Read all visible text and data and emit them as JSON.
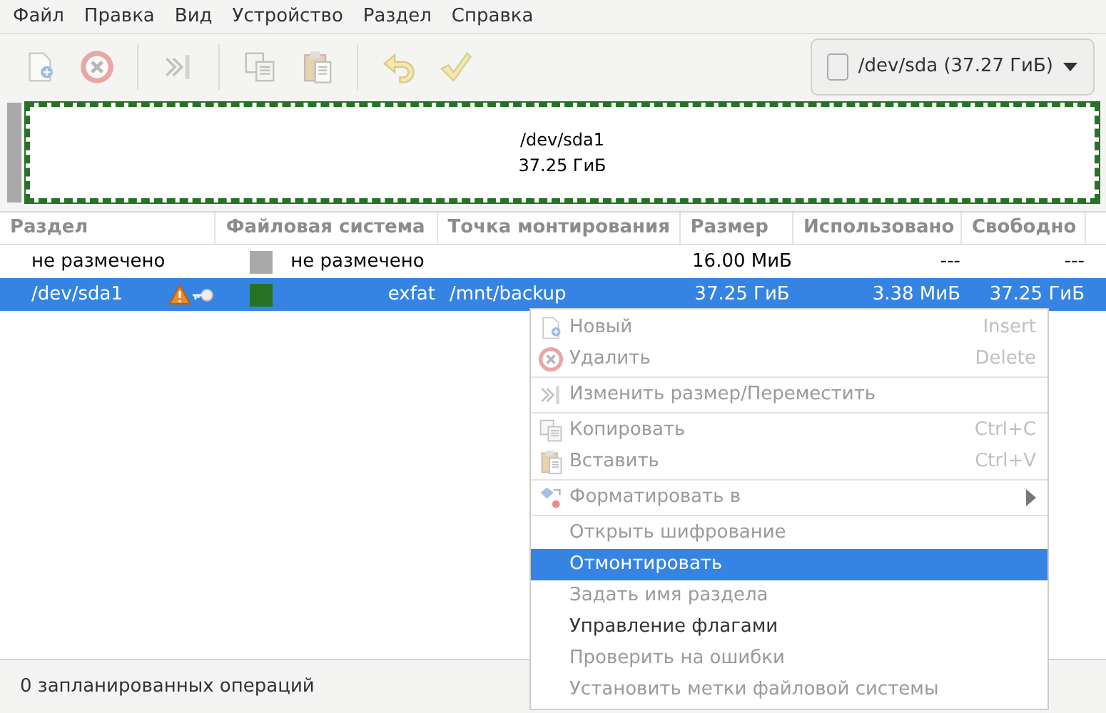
{
  "menubar": [
    "Файл",
    "Правка",
    "Вид",
    "Устройство",
    "Раздел",
    "Справка"
  ],
  "toolbar": [
    {
      "kind": "new",
      "disabled": true
    },
    {
      "kind": "delete",
      "disabled": true
    },
    {
      "kind": "separator"
    },
    {
      "kind": "resize",
      "disabled": true
    },
    {
      "kind": "separator"
    },
    {
      "kind": "copy",
      "disabled": true
    },
    {
      "kind": "paste",
      "disabled": true
    },
    {
      "kind": "separator"
    },
    {
      "kind": "undo",
      "disabled": true
    },
    {
      "kind": "apply",
      "disabled": true
    }
  ],
  "device_selector": {
    "value": "/dev/sda (37.27 ГиБ)"
  },
  "disk_graph": [
    {
      "kind": "unallocated",
      "color": "#a9a9a9"
    },
    {
      "kind": "partition",
      "color": "#267326",
      "name": "/dev/sda1",
      "size": "37.25 ГиБ"
    }
  ],
  "table": {
    "columns": [
      "Раздел",
      "Файловая система",
      "Точка монтирования",
      "Размер",
      "Использовано",
      "Свободно"
    ],
    "rows": [
      {
        "partition": "не размечено",
        "warning": false,
        "locked": false,
        "color": "#a9a9a9",
        "filesystem": "не размечено",
        "mount_point": "",
        "size": "16.00 МиБ",
        "used": "---",
        "free": "---",
        "selected": false
      },
      {
        "partition": "/dev/sda1",
        "warning": true,
        "locked": true,
        "color": "#267326",
        "filesystem": "exfat",
        "mount_point": "/mnt/backup",
        "size": "37.25 ГиБ",
        "used": "3.38 МиБ",
        "free": "37.25 ГиБ",
        "selected": true
      }
    ]
  },
  "context_menu": [
    {
      "kind": "item",
      "label": "Новый",
      "shortcut": "Insert",
      "disabled": true,
      "selected": false
    },
    {
      "kind": "item",
      "label": "Удалить",
      "shortcut": "Delete",
      "disabled": true,
      "selected": false
    },
    {
      "kind": "separator"
    },
    {
      "kind": "item",
      "label": "Изменить размер/Переместить",
      "disabled": true,
      "selected": false
    },
    {
      "kind": "separator"
    },
    {
      "kind": "item",
      "label": "Копировать",
      "shortcut": "Ctrl+C",
      "disabled": true,
      "selected": false
    },
    {
      "kind": "item",
      "label": "Вставить",
      "shortcut": "Ctrl+V",
      "disabled": true,
      "selected": false
    },
    {
      "kind": "separator"
    },
    {
      "kind": "submenu",
      "label": "Форматировать в",
      "disabled": true,
      "selected": false
    },
    {
      "kind": "separator"
    },
    {
      "kind": "item",
      "label": "Открыть шифрование",
      "disabled": true,
      "selected": false
    },
    {
      "kind": "item",
      "label": "Отмонтировать",
      "disabled": false,
      "selected": true
    },
    {
      "kind": "item",
      "label": "Задать имя раздела",
      "disabled": true,
      "selected": false
    },
    {
      "kind": "item",
      "label": "Управление флагами",
      "disabled": false,
      "selected": false
    },
    {
      "kind": "item",
      "label": "Проверить на ошибки",
      "disabled": true,
      "selected": false
    },
    {
      "kind": "item",
      "label": "Установить метки файловой системы",
      "disabled": true,
      "selected": false
    }
  ],
  "status_bar": "0 запланированных операций"
}
